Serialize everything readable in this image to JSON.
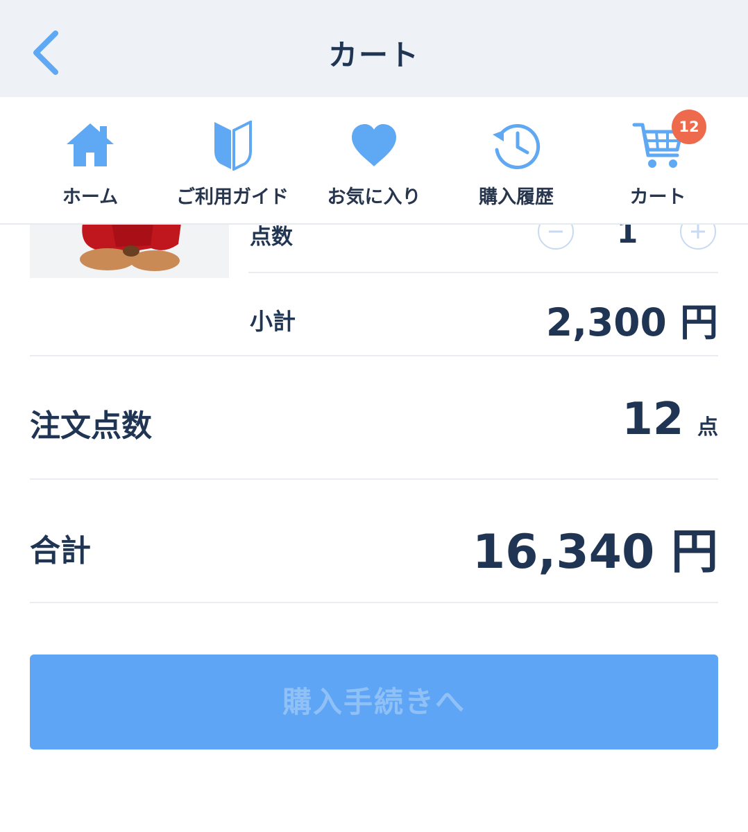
{
  "header": {
    "title": "カート"
  },
  "nav": {
    "items": [
      {
        "label": "ホーム",
        "icon": "home-icon"
      },
      {
        "label": "ご利用ガイド",
        "icon": "beginner-mark-icon"
      },
      {
        "label": "お気に入り",
        "icon": "heart-icon"
      },
      {
        "label": "購入履歴",
        "icon": "history-icon"
      },
      {
        "label": "カート",
        "icon": "cart-icon"
      }
    ],
    "cart_badge": "12"
  },
  "item": {
    "quantity_label": "点数",
    "quantity": "1",
    "subtotal_label": "小計",
    "subtotal_value": "2,300",
    "subtotal_unit": "円"
  },
  "summary": {
    "count_label": "注文点数",
    "count_value": "12",
    "count_unit": "点",
    "total_label": "合計",
    "total_value": "16,340",
    "total_unit": "円"
  },
  "checkout": {
    "label": "購入手続きへ"
  },
  "colors": {
    "accent": "#5ea8f4",
    "header_bg": "#eef1f5",
    "badge": "#ee6a4d",
    "text": "#1f3553",
    "button": "#5fa5f5"
  }
}
